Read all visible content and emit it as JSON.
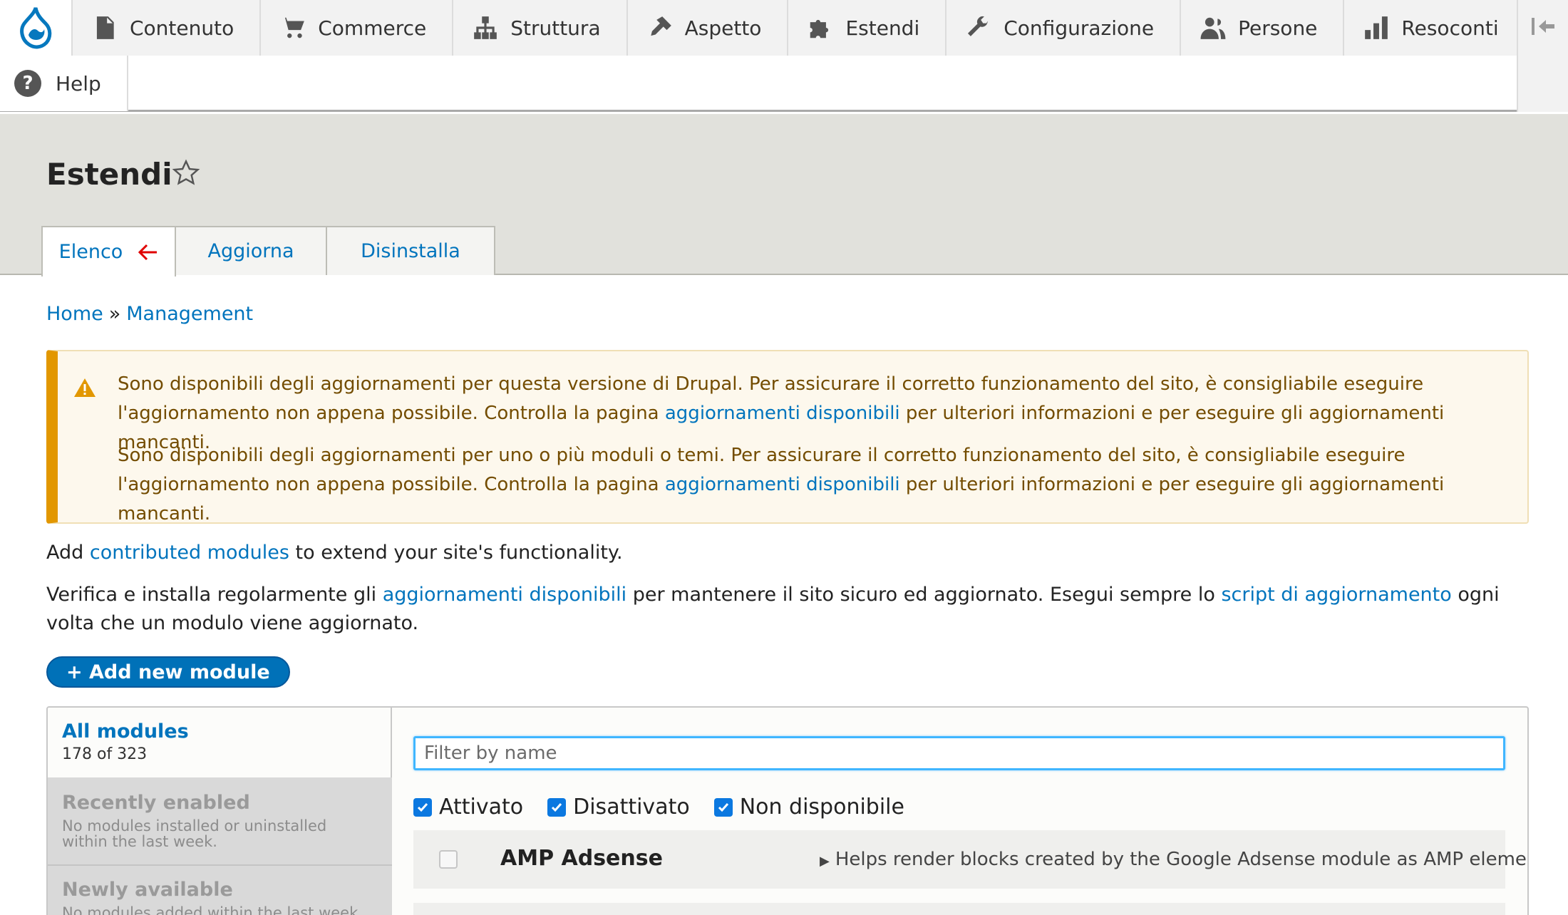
{
  "toolbar": {
    "items": [
      {
        "label": "Contenuto",
        "icon": "file-icon"
      },
      {
        "label": "Commerce",
        "icon": "cart-icon"
      },
      {
        "label": "Struttura",
        "icon": "sitemap-icon"
      },
      {
        "label": "Aspetto",
        "icon": "paintbrush-icon"
      },
      {
        "label": "Estendi",
        "icon": "puzzle-icon"
      },
      {
        "label": "Configurazione",
        "icon": "wrench-icon"
      },
      {
        "label": "Persone",
        "icon": "people-icon"
      },
      {
        "label": "Resoconti",
        "icon": "bar-chart-icon"
      }
    ],
    "help_label": "Help"
  },
  "header": {
    "title": "Estendi",
    "tabs": [
      "Elenco",
      "Aggiorna",
      "Disinstalla"
    ]
  },
  "breadcrumb": {
    "home": "Home",
    "separator": "»",
    "management": "Management"
  },
  "warning": {
    "msg1_a": "Sono disponibili degli aggiornamenti per questa versione di Drupal. Per assicurare il corretto funzionamento del sito, è consigliabile eseguire l'aggiornamento non appena possibile. Controlla la pagina ",
    "msg1_link": "aggiornamenti disponibili",
    "msg1_b": " per ulteriori informazioni e per eseguire gli aggiornamenti mancanti.",
    "msg2_a": "Sono disponibili degli aggiornamenti per uno o più moduli o temi. Per assicurare il corretto funzionamento del sito, è consigliabile eseguire l'aggiornamento non appena possibile. Controlla la pagina ",
    "msg2_link": "aggiornamenti disponibili",
    "msg2_b": " per ulteriori informazioni e per eseguire gli aggiornamenti mancanti."
  },
  "intro": {
    "p1_a": "Add ",
    "p1_link": "contributed modules",
    "p1_b": " to extend your site's functionality.",
    "p2_a": "Verifica e installa regolarmente gli ",
    "p2_link1": "aggiornamenti disponibili",
    "p2_b": " per mantenere il sito sicuro ed aggiornato. Esegui sempre lo ",
    "p2_link2": "script di aggiornamento",
    "p2_c": " ogni volta che un modulo viene aggiornato."
  },
  "add_module_label": "+ Add new module",
  "modules": {
    "sidebar": [
      {
        "title": "All modules",
        "desc": "178 of 323"
      },
      {
        "title": "Recently enabled",
        "desc": "No modules installed or uninstalled within the last week."
      },
      {
        "title": "Newly available",
        "desc": "No modules added within the last week."
      }
    ],
    "filter_placeholder": "Filter by name",
    "checkboxes": [
      "Attivato",
      "Disattivato",
      "Non disponibile"
    ],
    "rows": [
      {
        "name": "AMP Adsense",
        "description": "Helps render blocks created by the Google Adsense module as AMP elements"
      }
    ]
  },
  "colors": {
    "link": "#0074bd",
    "warning_border": "#e29700",
    "button": "#0071b8",
    "drupal_blue": "#0678be"
  }
}
